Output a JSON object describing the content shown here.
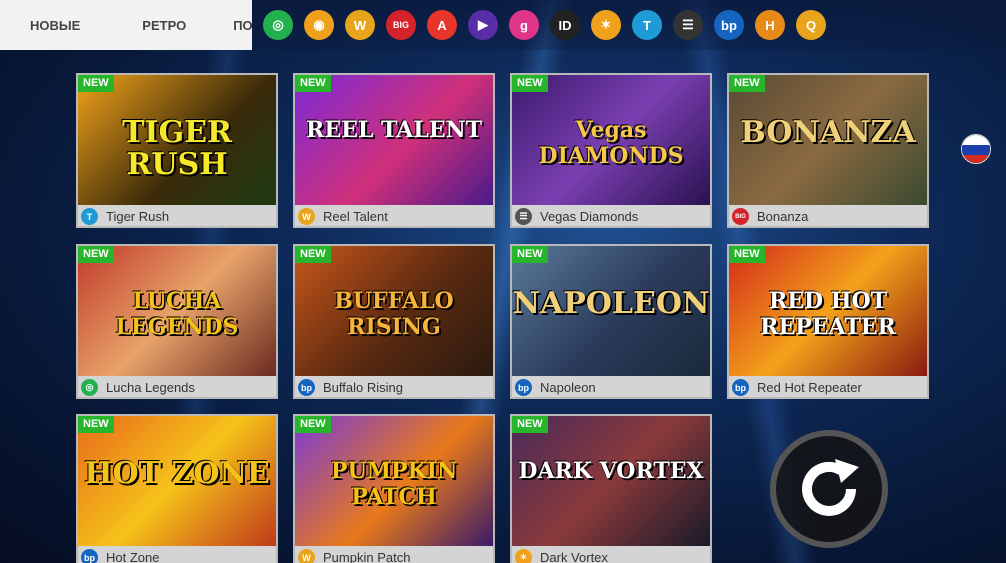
{
  "categories": [
    "НОВЫЕ",
    "РЕТРО",
    "ПОП"
  ],
  "providers": [
    {
      "icon": "lucha-provider-icon",
      "glyph": "◎",
      "color": "#23b14d"
    },
    {
      "icon": "flame-provider-icon",
      "glyph": "◉",
      "color": "#f0a11c"
    },
    {
      "icon": "w-provider-icon",
      "glyph": "W",
      "color": "#e8a41b"
    },
    {
      "icon": "big-provider-icon",
      "glyph": "BIG",
      "color": "#d4232a"
    },
    {
      "icon": "a-provider-icon",
      "glyph": "A",
      "color": "#e8352a"
    },
    {
      "icon": "play-provider-icon",
      "glyph": "▶",
      "color": "#5a2da8"
    },
    {
      "icon": "g-provider-icon",
      "glyph": "g",
      "color": "#e0338a"
    },
    {
      "icon": "id-provider-icon",
      "glyph": "ID",
      "color": "#222222"
    },
    {
      "icon": "star-provider-icon",
      "glyph": "✶",
      "color": "#f0a11c"
    },
    {
      "icon": "t-provider-icon",
      "glyph": "T",
      "color": "#1e9ad6"
    },
    {
      "icon": "list-provider-icon",
      "glyph": "☰",
      "color": "#333333"
    },
    {
      "icon": "bp-provider-icon",
      "glyph": "bp",
      "color": "#1565c0"
    },
    {
      "icon": "h-provider-icon",
      "glyph": "H",
      "color": "#e88a1a"
    },
    {
      "icon": "q-provider-icon",
      "glyph": "Q",
      "color": "#e8a41b"
    }
  ],
  "new_badge": "NEW",
  "games": [
    {
      "name": "Tiger Rush",
      "thumb_title": "TIGER RUSH",
      "title_color": "#f5e92a",
      "bg": "linear-gradient(135deg,#f3a21a,#3a2a0a 60%,#1d3b12)",
      "new": true,
      "provider_glyph": "T",
      "provider_color": "#1e9ad6"
    },
    {
      "name": "Reel Talent",
      "thumb_title": "REEL TALENT",
      "title_color": "#ffffff",
      "bg": "linear-gradient(135deg,#7b2ad6,#d0307a 55%,#4a1a8a)",
      "new": true,
      "provider_glyph": "W",
      "provider_color": "#e8a41b"
    },
    {
      "name": "Vegas Diamonds",
      "thumb_title": "Vegas DIAMONDS",
      "title_color": "#f6c84a",
      "bg": "linear-gradient(135deg,#3b1a6e,#7a3fb0 50%,#2a1150)",
      "new": true,
      "provider_glyph": "☰",
      "provider_color": "#555555"
    },
    {
      "name": "Bonanza",
      "thumb_title": "BONANZA",
      "title_color": "#f1d07a",
      "bg": "linear-gradient(135deg,#5a4a36,#8a6a40 50%,#3a4a30)",
      "new": true,
      "provider_glyph": "BIG",
      "provider_color": "#d4232a"
    },
    {
      "name": "Lucha Legends",
      "thumb_title": "LUCHA LEGENDS",
      "title_color": "#f5c21a",
      "bg": "linear-gradient(135deg,#c03a2a,#e8a36a 50%,#6a2a20)",
      "new": true,
      "provider_glyph": "◎",
      "provider_color": "#23b14d"
    },
    {
      "name": "Buffalo Rising",
      "thumb_title": "BUFFALO RISING",
      "title_color": "#f6b43a",
      "bg": "linear-gradient(135deg,#c8561a,#5a2a10 55%,#2a1a10)",
      "new": true,
      "provider_glyph": "bp",
      "provider_color": "#1565c0"
    },
    {
      "name": "Napoleon",
      "thumb_title": "NAPOLEON",
      "title_color": "#f1d07a",
      "bg": "linear-gradient(135deg,#5a7a9a,#2a3a5a 55%,#1a2a3a)",
      "new": true,
      "provider_glyph": "bp",
      "provider_color": "#1565c0"
    },
    {
      "name": "Red Hot Repeater",
      "thumb_title": "RED HOT REPEATER",
      "title_color": "#ffffff",
      "bg": "linear-gradient(135deg,#d42a1a,#f3a21a 50%,#8a1a10)",
      "new": true,
      "provider_glyph": "bp",
      "provider_color": "#1565c0"
    },
    {
      "name": "Hot Zone",
      "thumb_title": "HOT ZONE",
      "title_color": "#f5c21a",
      "bg": "linear-gradient(135deg,#e86a1a,#f5c21a 50%,#c03a1a)",
      "new": true,
      "provider_glyph": "bp",
      "provider_color": "#1565c0"
    },
    {
      "name": "Pumpkin Patch",
      "thumb_title": "PUMPKIN PATCH",
      "title_color": "#f5c21a",
      "bg": "linear-gradient(135deg,#7a3ad6,#e87a1a 55%,#3a1a6a)",
      "new": true,
      "provider_glyph": "W",
      "provider_color": "#e8a41b"
    },
    {
      "name": "Dark Vortex",
      "thumb_title": "DARK VORTEX",
      "title_color": "#ffffff",
      "bg": "linear-gradient(135deg,#4a2a5a,#8a3a3a 50%,#1a1a2a)",
      "new": true,
      "provider_glyph": "✶",
      "provider_color": "#f0a11c"
    }
  ],
  "flag_colors": [
    "#ffffff",
    "#1c3fae",
    "#d52b1e"
  ]
}
